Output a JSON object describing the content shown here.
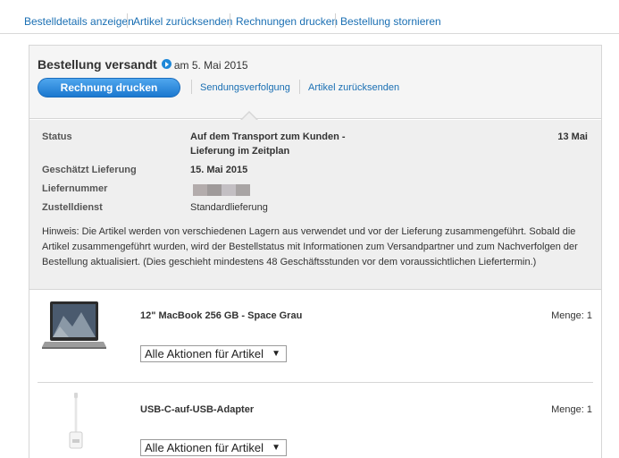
{
  "topnav": {
    "links": [
      "Bestelldetails anzeigen",
      "Artikel zurücksenden",
      "Rechnungen drucken",
      "Bestellung stornieren"
    ]
  },
  "order": {
    "title": "Bestellung versandt",
    "date": "am 5. Mai 2015",
    "invoice_button": "Rechnung drucken",
    "header_links": [
      "Sendungsverfolgung",
      "Artikel zurücksenden"
    ]
  },
  "details": {
    "status_label": "Status",
    "status_value_line1": "Auf dem Transport zum Kunden -",
    "status_value_line2": "Lieferung im Zeitplan",
    "status_date": "13 Mai",
    "delivery_label": "Geschätzt Lieferung",
    "delivery_value": "15. Mai 2015",
    "tracking_label": "Liefernummer",
    "carrier_label": "Zustelldienst",
    "carrier_value": "Standardlieferung",
    "hint": "Hinweis: Die Artikel werden von verschiedenen Lagern aus verwendet und vor der Lieferung zusammengeführt. Sobald die Artikel zusammengeführt wurden, wird der Bestellstatus mit Informationen zum Versandpartner und zum Nachverfolgen der Bestellung aktualisiert. (Dies geschieht mindestens 48 Geschäftsstunden vor dem voraussichtlichen Liefertermin.)"
  },
  "items": [
    {
      "name": "12\" MacBook 256 GB - Space Grau",
      "quantity": "Menge: 1",
      "actions": "Alle Aktionen für Artikel",
      "icon": "macbook-icon"
    },
    {
      "name": "USB-C-auf-USB-Adapter",
      "quantity": "Menge: 1",
      "actions": "Alle Aktionen für Artikel",
      "icon": "usb-adapter-icon"
    }
  ],
  "colors": {
    "link": "#1a6fb3",
    "button": "#1b78cf",
    "header_bg": "#f5f5f5",
    "details_bg": "#efefef"
  }
}
